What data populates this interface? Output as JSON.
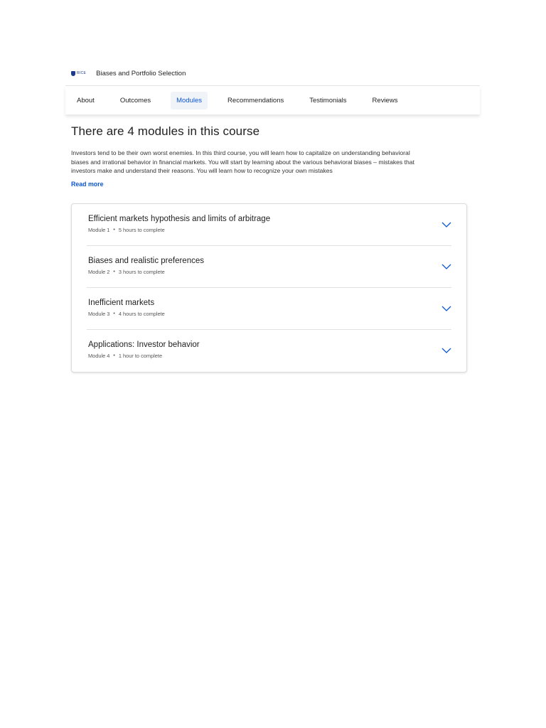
{
  "header": {
    "logo_text": "RICE",
    "course_title": "Biases and Portfolio Selection"
  },
  "tabs": [
    {
      "label": "About",
      "active": false
    },
    {
      "label": "Outcomes",
      "active": false
    },
    {
      "label": "Modules",
      "active": true
    },
    {
      "label": "Recommendations",
      "active": false
    },
    {
      "label": "Testimonials",
      "active": false
    },
    {
      "label": "Reviews",
      "active": false
    }
  ],
  "main": {
    "heading": "There are 4 modules in this course",
    "description": "Investors tend to be their own worst enemies. In this third course, you will learn how to capitalize on understanding behavioral biases and irrational behavior in financial markets. You will start by learning about the various behavioral biases – mistakes that investors make and understand their reasons. You will learn how to recognize your own mistakes",
    "read_more": "Read more"
  },
  "modules": [
    {
      "title": "Efficient markets hypothesis and limits of arbitrage",
      "number": "Module 1",
      "duration": "5 hours to complete"
    },
    {
      "title": "Biases and realistic preferences",
      "number": "Module 2",
      "duration": "3 hours to complete"
    },
    {
      "title": "Inefficient markets",
      "number": "Module 3",
      "duration": "4 hours to complete"
    },
    {
      "title": "Applications: Investor behavior",
      "number": "Module 4",
      "duration": "1 hour to complete"
    }
  ],
  "meta_separator": "•",
  "colors": {
    "accent": "#0b57d0",
    "logo": "#1f3a8a"
  }
}
